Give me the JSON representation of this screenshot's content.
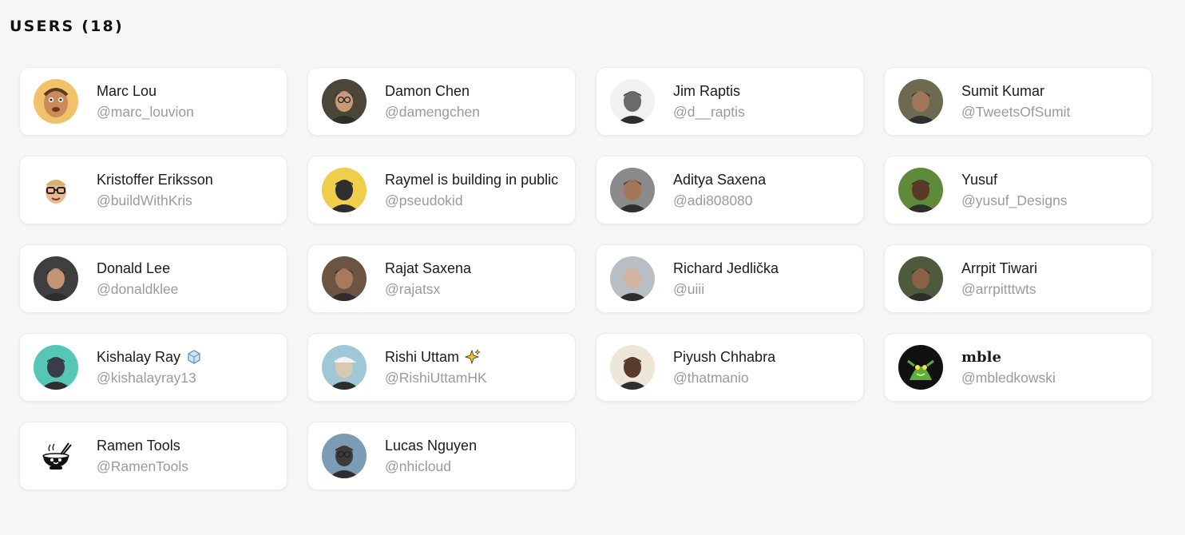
{
  "title": "USERS (18)",
  "users": [
    {
      "name": "Marc Lou",
      "handle": "@marc_louvion",
      "avatar": "cartoon-face",
      "colors": [
        "#f2c26b",
        "#c98b5a"
      ]
    },
    {
      "name": "Damon Chen",
      "handle": "@damengchen",
      "avatar": "man-glasses",
      "colors": [
        "#4a4638",
        "#c99a79"
      ]
    },
    {
      "name": "Jim Raptis",
      "handle": "@d__raptis",
      "avatar": "sketch-man",
      "colors": [
        "#f2f2f2",
        "#6a6a6a"
      ]
    },
    {
      "name": "Sumit Kumar",
      "handle": "@TweetsOfSumit",
      "avatar": "man-suit",
      "colors": [
        "#6e6a52",
        "#a0775b"
      ]
    },
    {
      "name": "Kristoffer Eriksson",
      "handle": "@buildWithKris",
      "avatar": "memoji-glasses",
      "colors": [
        "#ffffff",
        "#e8b992"
      ]
    },
    {
      "name": "Raymel is building in public",
      "handle": "@pseudokid",
      "avatar": "man-yellow-bg",
      "colors": [
        "#f0cd4a",
        "#2f2f2f"
      ]
    },
    {
      "name": "Aditya Saxena",
      "handle": "@adi808080",
      "avatar": "man-indoor",
      "colors": [
        "#8a8a8a",
        "#a37658"
      ]
    },
    {
      "name": "Yusuf",
      "handle": "@yusuf_Designs",
      "avatar": "man-green",
      "colors": [
        "#5e8a3a",
        "#5a3a26"
      ]
    },
    {
      "name": "Donald Lee",
      "handle": "@donaldklee",
      "avatar": "man-smile",
      "colors": [
        "#3f3f3f",
        "#c29577"
      ]
    },
    {
      "name": "Rajat Saxena",
      "handle": "@rajatsx",
      "avatar": "man-beard",
      "colors": [
        "#6b5542",
        "#a77a5a"
      ]
    },
    {
      "name": "Richard Jedlička",
      "handle": "@uiii",
      "avatar": "man-bald",
      "colors": [
        "#b9bec4",
        "#d2b4a1"
      ]
    },
    {
      "name": "Arrpit Tiwari",
      "handle": "@arrpitttwts",
      "avatar": "man-outdoor",
      "colors": [
        "#4d5a3c",
        "#8b6148"
      ]
    },
    {
      "name": "Kishalay Ray",
      "handle": "@kishalayray13",
      "avatar": "man-teal",
      "colors": [
        "#56c7b7",
        "#3a3c4a"
      ],
      "emoji": "ice-cube-emoji"
    },
    {
      "name": "Rishi Uttam",
      "handle": "@RishiUttamHK",
      "avatar": "man-cap",
      "colors": [
        "#9fc7d6",
        "#d8c9b2"
      ],
      "emoji": "sparkles-emoji"
    },
    {
      "name": "Piyush Chhabra",
      "handle": "@thatmanio",
      "avatar": "man-light",
      "colors": [
        "#efe6da",
        "#5a3a28"
      ]
    },
    {
      "name": "mble",
      "handle": "@mbledkowski",
      "avatar": "green-creature",
      "colors": [
        "#111111",
        "#5fae3b"
      ],
      "blackletter": true
    },
    {
      "name": "Ramen Tools",
      "handle": "@RamenTools",
      "avatar": "ramen-bowl",
      "colors": [
        "#ffffff",
        "#111111"
      ]
    },
    {
      "name": "Lucas Nguyen",
      "handle": "@nhicloud",
      "avatar": "man-outdoor-glasses",
      "colors": [
        "#7c9bb5",
        "#3b3b3b"
      ]
    }
  ]
}
